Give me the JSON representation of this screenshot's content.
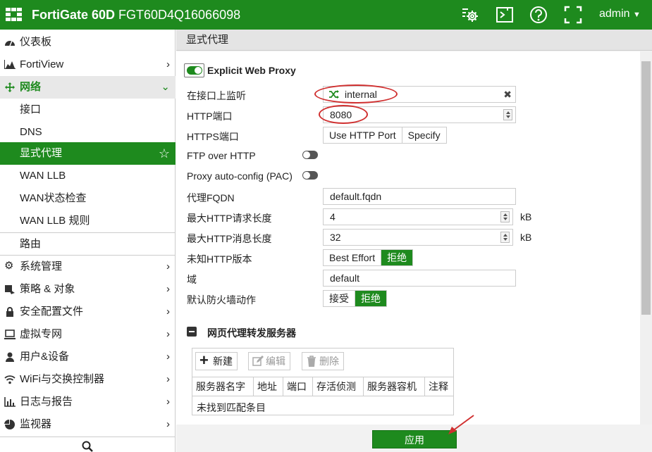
{
  "topbar": {
    "brand": "FortiGate 60D",
    "serial": "FGT60D4Q16066098",
    "user": "admin"
  },
  "sidebar": {
    "items": [
      {
        "label": "仪表板",
        "icon": "dashboard-icon"
      },
      {
        "label": "FortiView",
        "icon": "fortiview-icon"
      },
      {
        "label": "网络",
        "icon": "network-icon"
      },
      {
        "label": "接口"
      },
      {
        "label": "DNS"
      },
      {
        "label": "显式代理"
      },
      {
        "label": "WAN LLB"
      },
      {
        "label": "WAN状态检查"
      },
      {
        "label": "WAN LLB 规则"
      },
      {
        "label": "路由"
      },
      {
        "label": "系统管理",
        "icon": "gear-icon"
      },
      {
        "label": "策略 & 对象",
        "icon": "policy-icon"
      },
      {
        "label": "安全配置文件",
        "icon": "lock-icon"
      },
      {
        "label": "虚拟专网",
        "icon": "laptop-icon"
      },
      {
        "label": "用户&设备",
        "icon": "user-icon"
      },
      {
        "label": "WiFi与交换控制器",
        "icon": "wifi-icon"
      },
      {
        "label": "日志与报告",
        "icon": "log-icon"
      },
      {
        "label": "监视器",
        "icon": "monitor-icon"
      }
    ]
  },
  "page": {
    "title": "显式代理"
  },
  "form": {
    "explicit_web_proxy": "Explicit Web Proxy",
    "listen_label": "在接口上监听",
    "listen_value": "internal",
    "http_port_label": "HTTP端口",
    "http_port_value": "8080",
    "https_port_label": "HTTPS端口",
    "https_options": [
      "Use HTTP Port",
      "Specify"
    ],
    "ftp_label": "FTP over HTTP",
    "pac_label": "Proxy auto-config (PAC)",
    "fqdn_label": "代理FQDN",
    "fqdn_value": "default.fqdn",
    "max_req_label": "最大HTTP请求长度",
    "max_req_value": "4",
    "max_msg_label": "最大HTTP消息长度",
    "max_msg_value": "32",
    "unit": "kB",
    "unknown_ver_label": "未知HTTP版本",
    "unknown_ver_options": [
      "Best Effort",
      "拒绝"
    ],
    "realm_label": "域",
    "realm_value": "default",
    "fw_action_label": "默认防火墙动作",
    "fw_action_options": [
      "接受",
      "拒绝"
    ]
  },
  "forward": {
    "title": "网页代理转发服务器",
    "new": "新建",
    "edit": "编辑",
    "delete": "删除",
    "columns": [
      "服务器名字",
      "地址",
      "端口",
      "存活侦测",
      "服务器容机",
      "注释"
    ],
    "empty": "未找到匹配条目"
  },
  "apply": "应用"
}
